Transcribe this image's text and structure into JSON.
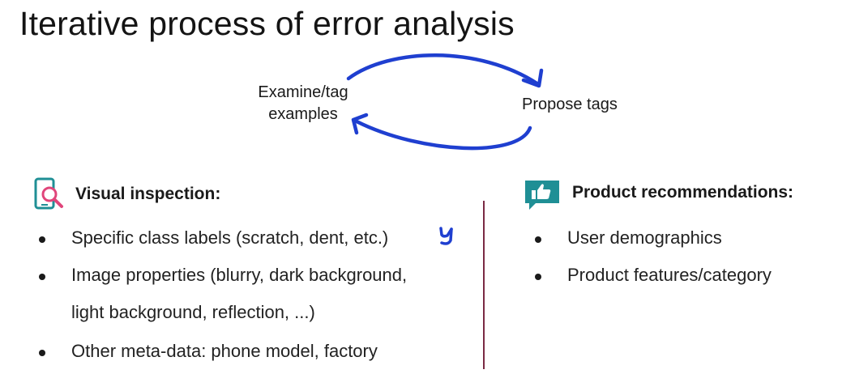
{
  "title": "Iterative process of error analysis",
  "cycle": {
    "examine": "Examine/tag examples",
    "examine_line1": "Examine/tag",
    "examine_line2": "examples",
    "propose": "Propose tags",
    "arrow_color": "#1f3fd0"
  },
  "visual": {
    "heading": "Visual inspection:",
    "icon": "phone-magnifier-icon",
    "items": [
      "Specific class labels (scratch, dent, etc.)",
      "Image properties (blurry, dark background,",
      "light background, reflection, ...)",
      "Other meta-data: phone model, factory"
    ],
    "annotation": "y"
  },
  "product": {
    "heading": "Product recommendations:",
    "icon": "thumbs-up-icon",
    "items": [
      "User demographics",
      "Product features/category"
    ]
  },
  "colors": {
    "divider": "#7a2a44",
    "icon_teal": "#1f8f95",
    "icon_pink": "#e0457a"
  }
}
